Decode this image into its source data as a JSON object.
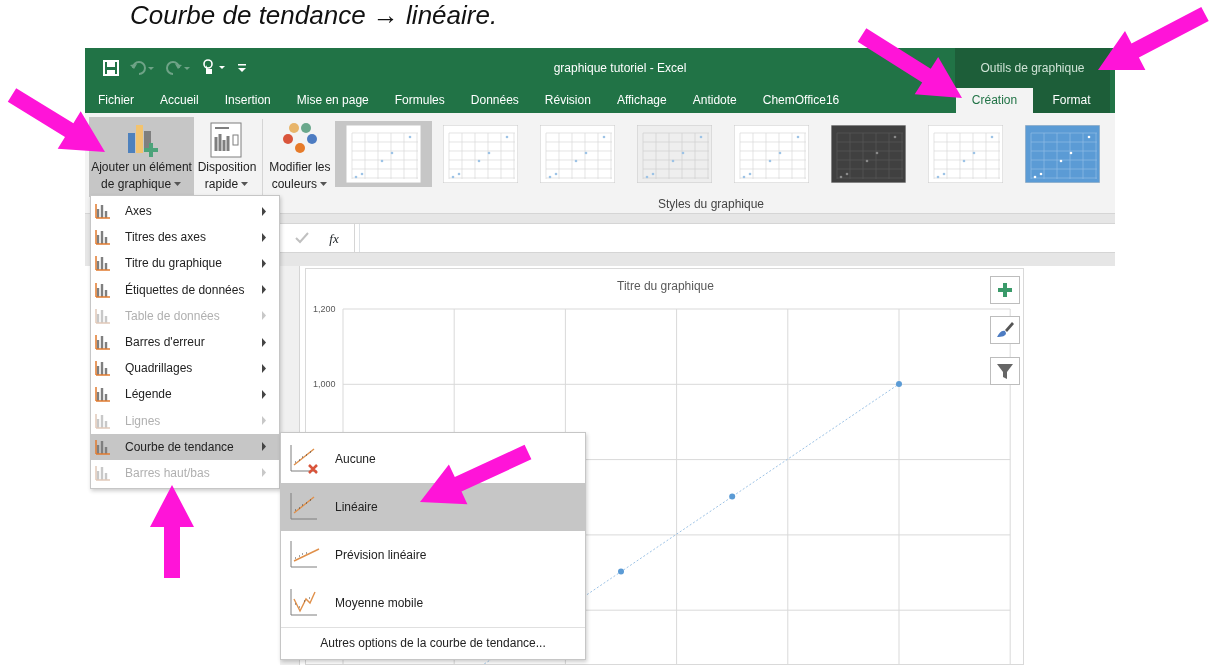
{
  "caption": "Courbe de tendance → linéaire.",
  "window": {
    "title": "graphique tutoriel - Excel",
    "context_label": "Outils de graphique"
  },
  "tabs": [
    {
      "label": "Fichier",
      "selected": false,
      "contextual": false
    },
    {
      "label": "Accueil",
      "selected": false,
      "contextual": false
    },
    {
      "label": "Insertion",
      "selected": false,
      "contextual": false
    },
    {
      "label": "Mise en page",
      "selected": false,
      "contextual": false
    },
    {
      "label": "Formules",
      "selected": false,
      "contextual": false
    },
    {
      "label": "Données",
      "selected": false,
      "contextual": false
    },
    {
      "label": "Révision",
      "selected": false,
      "contextual": false
    },
    {
      "label": "Affichage",
      "selected": false,
      "contextual": false
    },
    {
      "label": "Antidote",
      "selected": false,
      "contextual": false
    },
    {
      "label": "ChemOffice16",
      "selected": false,
      "contextual": false
    },
    {
      "label": "Création",
      "selected": true,
      "contextual": true
    },
    {
      "label": "Format",
      "selected": false,
      "contextual": true
    }
  ],
  "ribbon": {
    "buttons": [
      {
        "kind": "add",
        "lines": [
          "Ajouter un élément",
          "de graphique"
        ],
        "pressed": true
      },
      {
        "kind": "layout",
        "lines": [
          "Disposition",
          "rapide"
        ],
        "pressed": false
      },
      {
        "kind": "colors",
        "lines": [
          "Modifier les",
          "couleurs"
        ],
        "pressed": false
      }
    ],
    "styles": [
      {
        "kind": "white",
        "selected": true
      },
      {
        "kind": "white",
        "selected": false
      },
      {
        "kind": "white",
        "selected": false
      },
      {
        "kind": "grey",
        "selected": false
      },
      {
        "kind": "white",
        "selected": false
      },
      {
        "kind": "dark",
        "selected": false
      },
      {
        "kind": "white",
        "selected": false
      },
      {
        "kind": "blue",
        "selected": false
      }
    ],
    "group_label": "Styles du graphique"
  },
  "formula_bar": {
    "fx": "fx"
  },
  "chart": {
    "title": "Titre du graphique",
    "y_labels": [
      "1,200",
      "1,000"
    ]
  },
  "menu": {
    "items": [
      {
        "label": "Axes",
        "disabled": false,
        "selected": false
      },
      {
        "label": "Titres des axes",
        "disabled": false,
        "selected": false
      },
      {
        "label": "Titre du graphique",
        "disabled": false,
        "selected": false
      },
      {
        "label": "Étiquettes de données",
        "disabled": false,
        "selected": false
      },
      {
        "label": "Table de données",
        "disabled": true,
        "selected": false
      },
      {
        "label": "Barres d'erreur",
        "disabled": false,
        "selected": false
      },
      {
        "label": "Quadrillages",
        "disabled": false,
        "selected": false
      },
      {
        "label": "Légende",
        "disabled": false,
        "selected": false
      },
      {
        "label": "Lignes",
        "disabled": true,
        "selected": false
      },
      {
        "label": "Courbe de tendance",
        "disabled": false,
        "selected": true
      },
      {
        "label": "Barres haut/bas",
        "disabled": true,
        "selected": false
      }
    ]
  },
  "submenu": {
    "items": [
      {
        "kind": "none",
        "label": "Aucune",
        "selected": false
      },
      {
        "kind": "linear",
        "label": "Linéaire",
        "selected": true
      },
      {
        "kind": "forecast",
        "label": "Prévision linéaire",
        "selected": false
      },
      {
        "kind": "moving",
        "label": "Moyenne mobile",
        "selected": false
      }
    ],
    "footer": "Autres options de la courbe de tendance..."
  }
}
